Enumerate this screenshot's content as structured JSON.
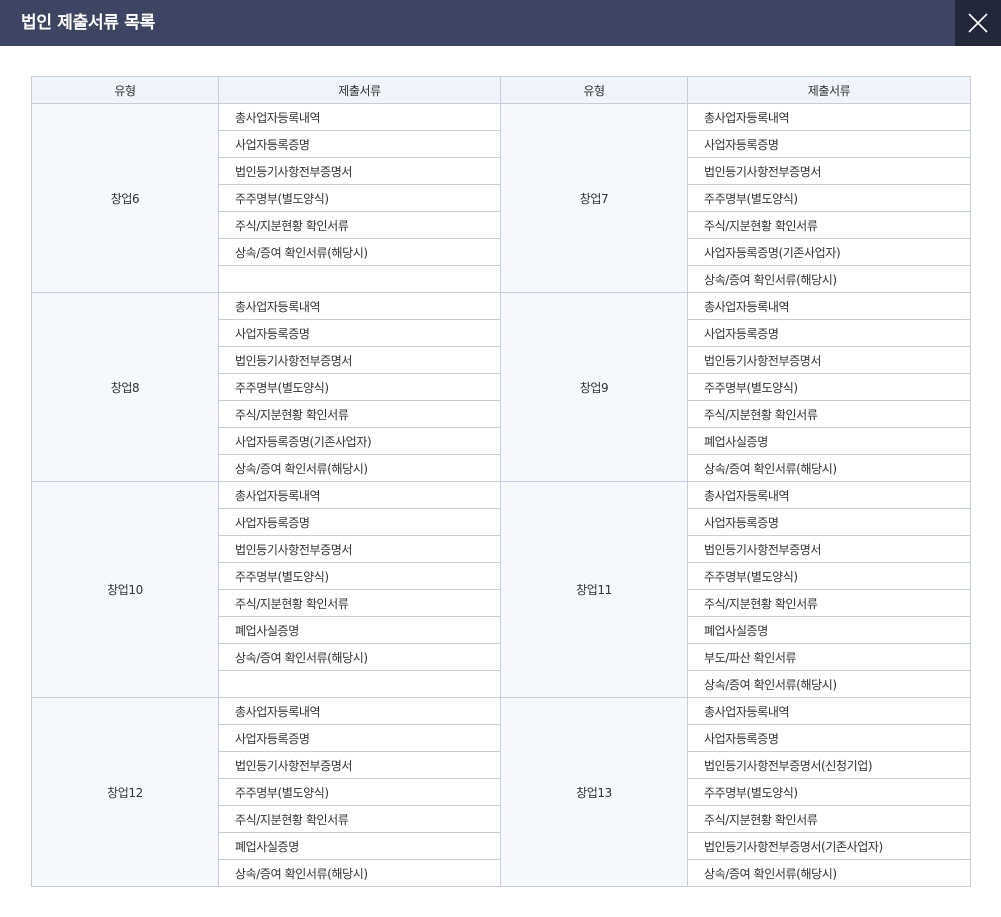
{
  "modal": {
    "title": "법인 제출서류 목록",
    "close_icon": "close-icon"
  },
  "table": {
    "headers": [
      "유형",
      "제출서류",
      "유형",
      "제출서류"
    ],
    "groups": [
      {
        "rows": 7,
        "left": {
          "type": "창업6",
          "docs": [
            "총사업자등록내역",
            "사업자등록증명",
            "법인등기사항전부증명서",
            "주주명부(별도양식)",
            "주식/지분현황 확인서류",
            "상속/증여 확인서류(해당시)",
            ""
          ]
        },
        "right": {
          "type": "창업7",
          "docs": [
            "총사업자등록내역",
            "사업자등록증명",
            "법인등기사항전부증명서",
            "주주명부(별도양식)",
            "주식/지분현황 확인서류",
            "사업자등록증명(기존사업자)",
            "상속/증여 확인서류(해당시)"
          ]
        }
      },
      {
        "rows": 7,
        "left": {
          "type": "창업8",
          "docs": [
            "총사업자등록내역",
            "사업자등록증명",
            "법인등기사항전부증명서",
            "주주명부(별도양식)",
            "주식/지분현황 확인서류",
            "사업자등록증명(기존사업자)",
            "상속/증여 확인서류(해당시)"
          ]
        },
        "right": {
          "type": "창업9",
          "docs": [
            "총사업자등록내역",
            "사업자등록증명",
            "법인등기사항전부증명서",
            "주주명부(별도양식)",
            "주식/지분현황 확인서류",
            "폐업사실증명",
            "상속/증여 확인서류(해당시)"
          ]
        }
      },
      {
        "rows": 8,
        "left": {
          "type": "창업10",
          "docs": [
            "총사업자등록내역",
            "사업자등록증명",
            "법인등기사항전부증명서",
            "주주명부(별도양식)",
            "주식/지분현황 확인서류",
            "폐업사실증명",
            "상속/증여 확인서류(해당시)",
            ""
          ]
        },
        "right": {
          "type": "창업11",
          "docs": [
            "총사업자등록내역",
            "사업자등록증명",
            "법인등기사항전부증명서",
            "주주명부(별도양식)",
            "주식/지분현황 확인서류",
            "폐업사실증명",
            "부도/파산 확인서류",
            "상속/증여 확인서류(해당시)"
          ]
        }
      },
      {
        "rows": 7,
        "left": {
          "type": "창업12",
          "docs": [
            "총사업자등록내역",
            "사업자등록증명",
            "법인등기사항전부증명서",
            "주주명부(별도양식)",
            "주식/지분현황 확인서류",
            "폐업사실증명",
            "상속/증여 확인서류(해당시)"
          ]
        },
        "right": {
          "type": "창업13",
          "docs": [
            "총사업자등록내역",
            "사업자등록증명",
            "법인등기사항전부증명서(신청기업)",
            "주주명부(별도양식)",
            "주식/지분현황 확인서류",
            "법인등기사항전부증명서(기존사업자)",
            "상속/증여 확인서류(해당시)"
          ]
        }
      }
    ]
  },
  "colors": {
    "header_bg": "#3e4563",
    "close_bg": "#22273a",
    "table_border": "#c7cfdd",
    "table_header_bg": "#f1f4fa",
    "type_cell_bg": "#f6f8fc"
  }
}
